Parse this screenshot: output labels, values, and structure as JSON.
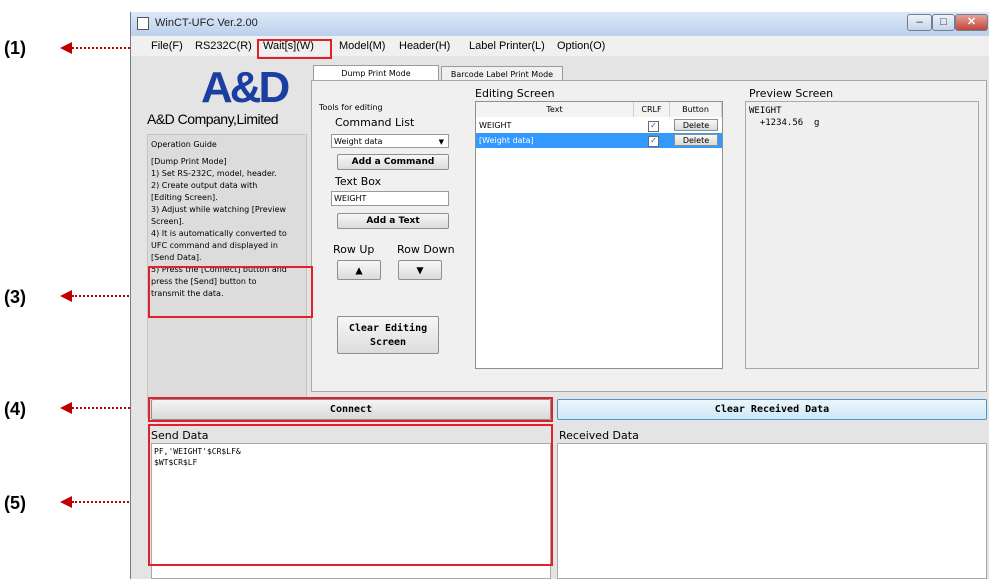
{
  "window": {
    "title": "WinCT-UFC  Ver.2.00",
    "controls": {
      "minimize": "–",
      "maximize": "□",
      "close": "✕"
    }
  },
  "menu": [
    "File(F)",
    "RS232C(R)",
    "Wait[s](W)",
    "Model(M)",
    "Header(H)",
    "Label Printer(L)",
    "Option(O)"
  ],
  "logo": {
    "brand": "A&D",
    "company": "A&D Company,Limited"
  },
  "guide": {
    "title": "Operation Guide",
    "lines": [
      "[Dump Print Mode]",
      "1) Set RS-232C, model, header.",
      "2) Create output data with",
      "[Editing Screen].",
      "3) Adjust while watching [Preview",
      "Screen].",
      "4) It is automatically converted to",
      "UFC command and displayed in",
      "[Send Data].",
      "5) Press the [Connect] button and",
      "press the [Send] button to",
      "transmit the data."
    ]
  },
  "tabs": [
    "Dump Print Mode",
    "Barcode Label Print Mode"
  ],
  "tools": {
    "title": "Tools for editing",
    "command_list_label": "Command List",
    "command_list_value": "Weight data",
    "add_command": "Add a Command",
    "text_box_label": "Text Box",
    "text_box_value": "WEIGHT",
    "add_text": "Add a Text",
    "row_up_label": "Row Up",
    "row_down_label": "Row Down",
    "row_up_icon": "▲",
    "row_down_icon": "▼",
    "clear_line1": "Clear Editing",
    "clear_line2": "Screen"
  },
  "editing": {
    "title": "Editing Screen",
    "headers": [
      "Text",
      "CRLF",
      "Button"
    ],
    "rows": [
      {
        "text": "WEIGHT",
        "crlf": "✓",
        "button": "Delete"
      },
      {
        "text": "[Weight data]",
        "crlf": "✓",
        "button": "Delete"
      }
    ]
  },
  "preview": {
    "title": "Preview Screen",
    "line1": "WEIGHT",
    "line2": "  +1234.56  g"
  },
  "connect_button": "Connect",
  "clear_received_button": "Clear Received Data",
  "send_data": {
    "title": "Send Data",
    "line1": "PF,'WEIGHT'$CR$LF&",
    "line2": "$WT$CR$LF"
  },
  "received_data": {
    "title": "Received Data"
  },
  "callouts": [
    "(1)",
    "(3)",
    "(4)",
    "(5)"
  ],
  "colors": {
    "callout_red": "#e0202a",
    "selection_blue": "#3399ff"
  }
}
